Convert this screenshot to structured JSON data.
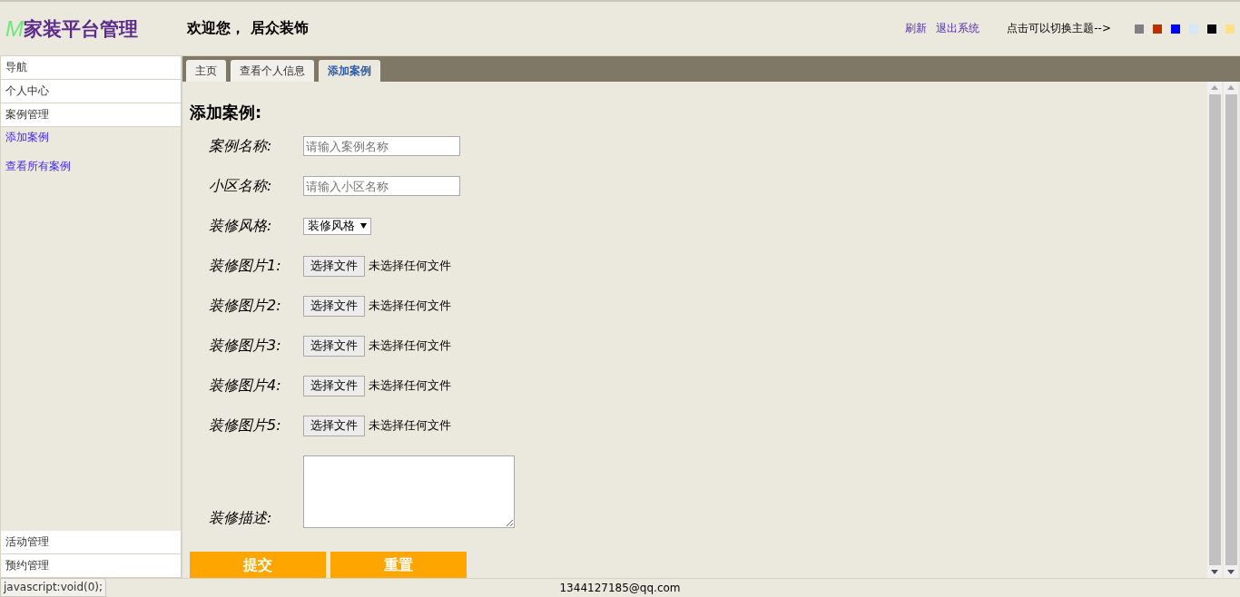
{
  "header": {
    "logo_mark": "M",
    "title": "家装平台管理",
    "welcome": "欢迎您， 居众装饰",
    "links": [
      "刷新",
      "退出系统"
    ],
    "theme_hint": "点击可以切换主题-->",
    "themes": [
      {
        "color": "#808080"
      },
      {
        "color": "#b83200"
      },
      {
        "color": "#0000ff"
      },
      {
        "color": "#d6e8f8"
      },
      {
        "color": "#000000"
      },
      {
        "color": "#fce184"
      }
    ]
  },
  "sidebar": {
    "top": [
      {
        "label": "导航",
        "kind": "section"
      },
      {
        "label": "个人中心",
        "kind": "section"
      },
      {
        "label": "案例管理",
        "kind": "section"
      },
      {
        "label": "添加案例",
        "kind": "link"
      },
      {
        "label": "查看所有案例",
        "kind": "link"
      }
    ],
    "bottom": [
      {
        "label": "活动管理",
        "kind": "section"
      },
      {
        "label": "预约管理",
        "kind": "section"
      }
    ]
  },
  "tabs": [
    {
      "label": "主页",
      "selected": false
    },
    {
      "label": "查看个人信息",
      "selected": false
    },
    {
      "label": "添加案例",
      "selected": true
    }
  ],
  "form": {
    "title": "添加案例:",
    "fields": [
      {
        "kind": "text",
        "label": "案例名称:",
        "placeholder": "请输入案例名称"
      },
      {
        "kind": "text",
        "label": "小区名称:",
        "placeholder": "请输入小区名称"
      },
      {
        "kind": "select",
        "label": "装修风格:",
        "value": "装修风格"
      },
      {
        "kind": "file",
        "label": "装修图片1:",
        "button": "选择文件",
        "status": "未选择任何文件"
      },
      {
        "kind": "file",
        "label": "装修图片2:",
        "button": "选择文件",
        "status": "未选择任何文件"
      },
      {
        "kind": "file",
        "label": "装修图片3:",
        "button": "选择文件",
        "status": "未选择任何文件"
      },
      {
        "kind": "file",
        "label": "装修图片4:",
        "button": "选择文件",
        "status": "未选择任何文件"
      },
      {
        "kind": "file",
        "label": "装修图片5:",
        "button": "选择文件",
        "status": "未选择任何文件"
      },
      {
        "kind": "textarea",
        "label": "装修描述:"
      }
    ],
    "buttons": [
      "提交",
      "重置"
    ]
  },
  "footer": {
    "email": "1344127185@qq.com"
  },
  "status_tooltip": "javascript:void(0);"
}
